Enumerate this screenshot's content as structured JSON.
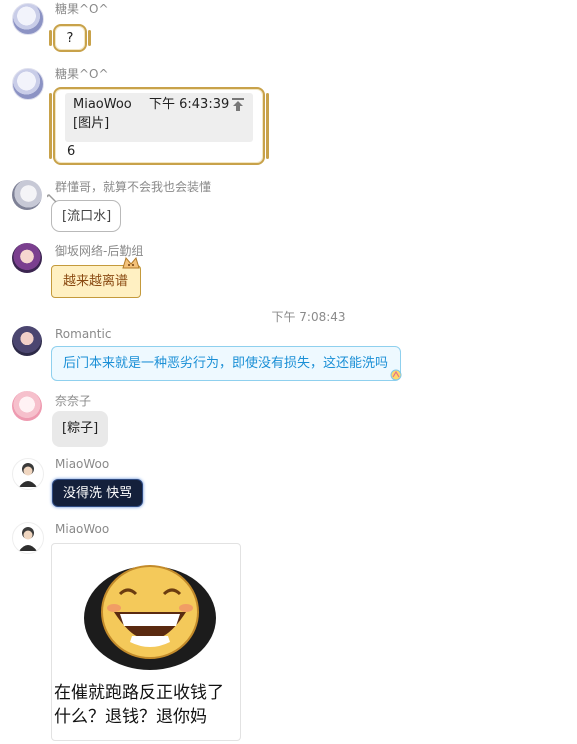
{
  "messages": [
    {
      "sender": "糖果^O^",
      "text": "?"
    },
    {
      "sender": "糖果^O^",
      "quote": {
        "author": "MiaoWoo",
        "time": "下午 6:43:39",
        "content": "[图片]"
      },
      "text": "6"
    },
    {
      "sender": "群懂哥，就算不会我也会装懂",
      "text": "[流口水]"
    },
    {
      "sender": "御坂网络-后勤组",
      "text": "越来越离谱"
    },
    {
      "sender": "Romantic",
      "text": "后门本来就是一种恶劣行为，即使没有损失，这还能洗吗"
    },
    {
      "sender": "奈奈子",
      "text": "[粽子]"
    },
    {
      "sender": "MiaoWoo",
      "text": "没得洗 快骂"
    },
    {
      "sender": "MiaoWoo",
      "image": {
        "caption_line1": "在催就跑路反正收钱了",
        "caption_line2": "什么？退钱？退你妈"
      }
    }
  ],
  "timestamp": "下午 7:08:43",
  "colors": {
    "sender_gray": "#8a8a8a",
    "gold_border": "#c8a24a",
    "blue_text": "#1a8fd6",
    "yellow_bg": "#fff0c2",
    "dark_bubble": "#14203b"
  }
}
